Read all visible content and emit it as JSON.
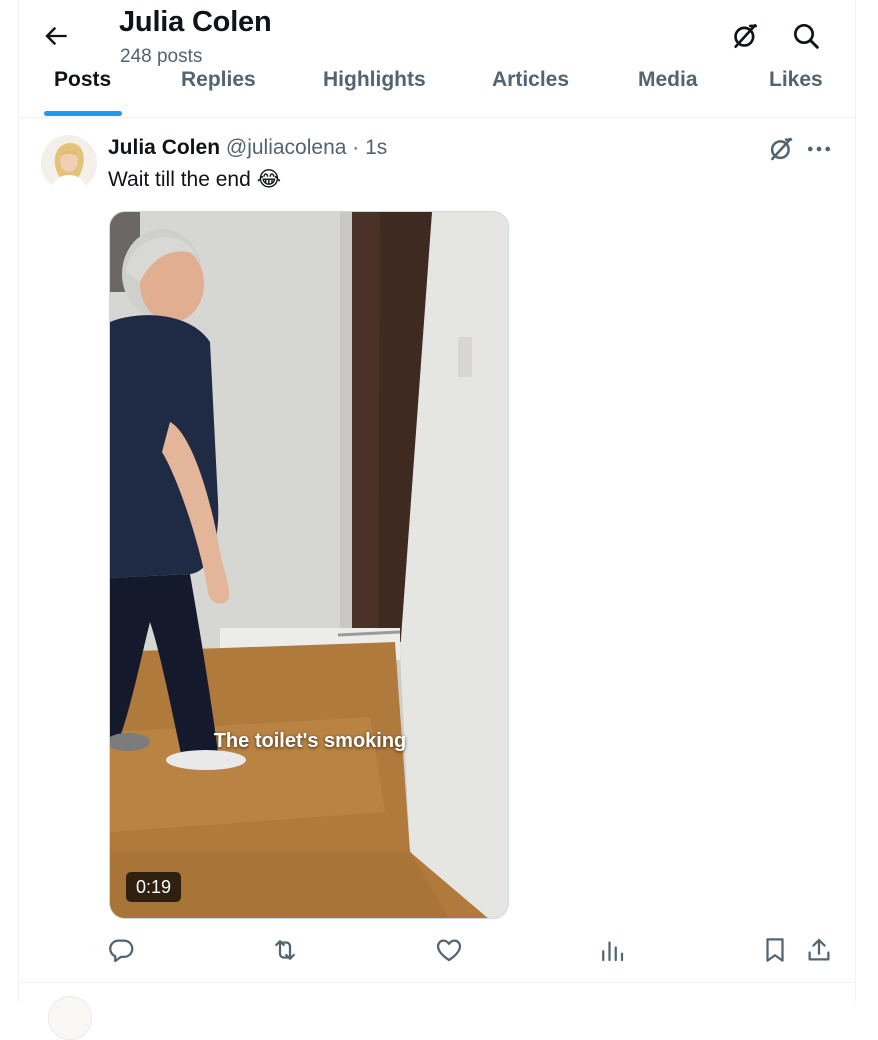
{
  "header": {
    "name": "Julia Colen",
    "post_count": "248 posts"
  },
  "tabs": [
    {
      "label": "Posts",
      "active": true
    },
    {
      "label": "Replies"
    },
    {
      "label": "Highlights"
    },
    {
      "label": "Articles"
    },
    {
      "label": "Media"
    },
    {
      "label": "Likes"
    }
  ],
  "post": {
    "author": "Julia Colen",
    "handle": "@juliacolena · 1s",
    "text": "Wait till the end 😂",
    "video": {
      "caption": "The toilet's smoking",
      "duration": "0:19"
    }
  },
  "icons": {
    "back": "arrow-left-icon",
    "grok": "grok-icon",
    "search": "search-icon",
    "more": "more-icon",
    "reply": "reply-icon",
    "repost": "repost-icon",
    "like": "heart-icon",
    "views": "views-icon",
    "bookmark": "bookmark-icon",
    "share": "share-icon"
  },
  "colors": {
    "accent": "#1d9bf0",
    "text": "#0f1419",
    "secondary": "#536471",
    "action_icons": "#536471",
    "divider": "#eff3f4"
  }
}
